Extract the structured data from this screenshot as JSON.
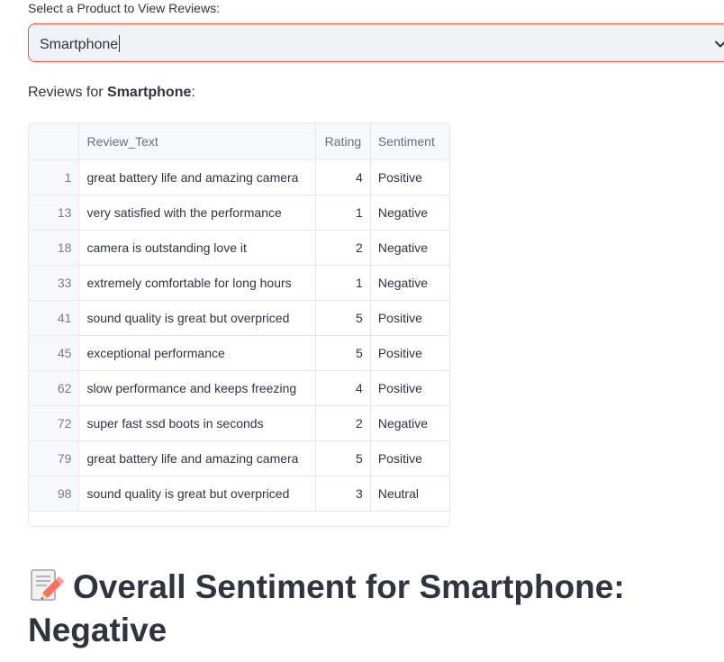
{
  "select": {
    "label": "Select a Product to View Reviews:",
    "value": "Smartphone"
  },
  "reviews_heading": {
    "prefix": "Reviews for ",
    "product": "Smartphone",
    "suffix": ":"
  },
  "table": {
    "columns": [
      "",
      "Review_Text",
      "Rating",
      "Sentiment"
    ],
    "rows": [
      {
        "index": "1",
        "text": "great battery life and amazing camera",
        "rating": "4",
        "sentiment": "Positive"
      },
      {
        "index": "13",
        "text": "very satisfied with the performance",
        "rating": "1",
        "sentiment": "Negative"
      },
      {
        "index": "18",
        "text": "camera is outstanding love it",
        "rating": "2",
        "sentiment": "Negative"
      },
      {
        "index": "33",
        "text": "extremely comfortable for long hours",
        "rating": "1",
        "sentiment": "Negative"
      },
      {
        "index": "41",
        "text": "sound quality is great but overpriced",
        "rating": "5",
        "sentiment": "Positive"
      },
      {
        "index": "45",
        "text": "exceptional performance",
        "rating": "5",
        "sentiment": "Positive"
      },
      {
        "index": "62",
        "text": "slow performance and keeps freezing",
        "rating": "4",
        "sentiment": "Positive"
      },
      {
        "index": "72",
        "text": "super fast ssd boots in seconds",
        "rating": "2",
        "sentiment": "Negative"
      },
      {
        "index": "79",
        "text": "great battery life and amazing camera",
        "rating": "5",
        "sentiment": "Positive"
      },
      {
        "index": "98",
        "text": "sound quality is great but overpriced",
        "rating": "3",
        "sentiment": "Neutral"
      }
    ]
  },
  "overall": {
    "icon": "memo-icon",
    "line1": "Overall Sentiment for Smartphone:",
    "line2": "Negative"
  },
  "colors": {
    "accent": "#ff4b4b",
    "text": "#31333f",
    "border": "#e6e8ee"
  }
}
